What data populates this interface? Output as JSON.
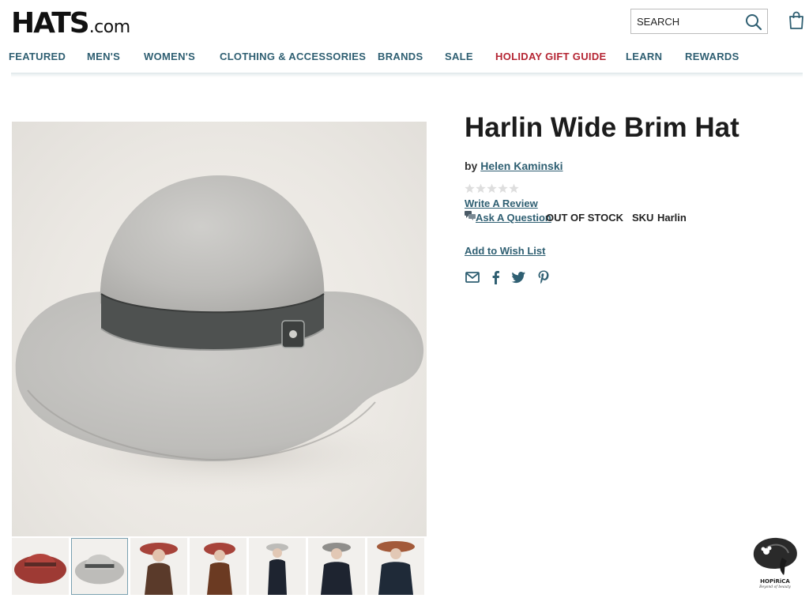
{
  "header": {
    "logo_main": "HATS",
    "logo_suffix": ".com",
    "search_placeholder": "SEARCH",
    "nav": [
      {
        "label": "FEATURED"
      },
      {
        "label": "MEN'S"
      },
      {
        "label": "WOMEN'S"
      },
      {
        "label": "CLOTHING & ACCESSORIES"
      },
      {
        "label": "BRANDS"
      },
      {
        "label": "SALE"
      },
      {
        "label": "HOLIDAY GIFT GUIDE",
        "highlight": true
      },
      {
        "label": "LEARN"
      },
      {
        "label": "REWARDS"
      }
    ]
  },
  "product": {
    "title": "Harlin Wide Brim Hat",
    "by_prefix": "by",
    "brand": "Helen Kaminski",
    "rating": 0,
    "max_rating": 5,
    "write_review": "Write A Review",
    "ask_question": "Ask A Question",
    "stock_status": "OUT OF STOCK",
    "sku_label": "SKU",
    "sku_value": "Harlin",
    "wishlist": "Add to Wish List",
    "share": [
      "email-icon",
      "facebook-icon",
      "twitter-icon",
      "pinterest-icon"
    ]
  },
  "gallery": {
    "thumbnails": [
      {
        "name": "thumb-red-hat"
      },
      {
        "name": "thumb-grey-hat",
        "active": true
      },
      {
        "name": "thumb-model-red-hat-1"
      },
      {
        "name": "thumb-model-red-hat-2"
      },
      {
        "name": "thumb-model-grey-hat-1"
      },
      {
        "name": "thumb-model-grey-hat-2"
      },
      {
        "name": "thumb-model-rust-hat"
      }
    ]
  },
  "watermark": {
    "name": "HOPiRiCA",
    "tagline": "Beyond of beauty"
  },
  "colors": {
    "link": "#2f5f72",
    "highlight": "#b52634",
    "text": "#1c1c1c"
  }
}
